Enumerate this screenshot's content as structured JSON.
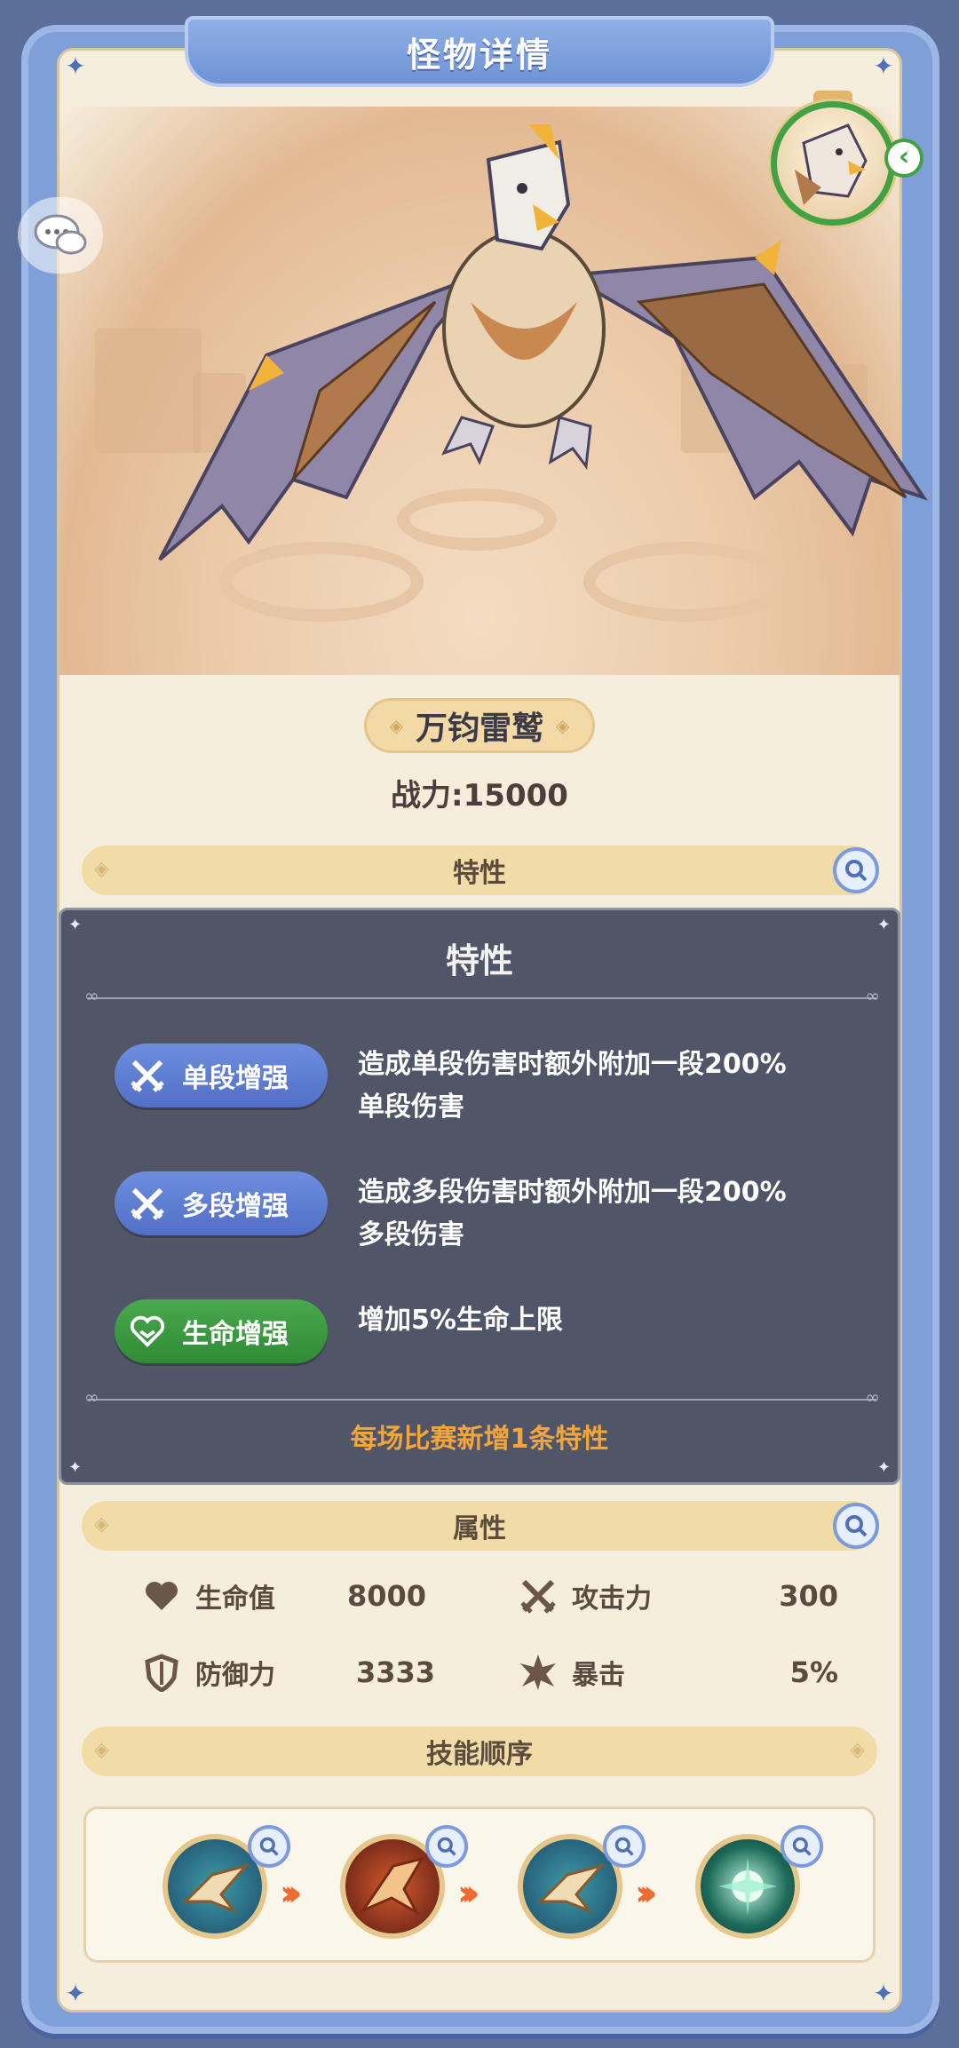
{
  "header": {
    "title": "怪物详情"
  },
  "monster": {
    "name": "万钧雷鹫",
    "power": "战力:15000"
  },
  "sections": {
    "traits": "特性",
    "attributes": "属性",
    "skill_order": "技能顺序"
  },
  "attributes": [
    {
      "icon": "heart-icon",
      "label": "生命值",
      "value": "8000"
    },
    {
      "icon": "crossed-swords-icon",
      "label": "攻击力",
      "value": "300"
    },
    {
      "icon": "shield-icon",
      "label": "防御力",
      "value": "3333"
    },
    {
      "icon": "starburst-icon",
      "label": "暴击",
      "value": "5%"
    }
  ],
  "skills": [
    {
      "icon": "eagle-skill-icon"
    },
    {
      "icon": "fire-bird-skill-icon"
    },
    {
      "icon": "eagle-skill-icon"
    },
    {
      "icon": "energy-orb-skill-icon"
    }
  ],
  "popup": {
    "title": "特性",
    "traits": [
      {
        "name": "单段增强",
        "icon": "crossed-swords-icon",
        "color": "#5a78d0",
        "desc_line1": "造成单段伤害时额外附加一段200%",
        "desc_line2": "单段伤害"
      },
      {
        "name": "多段增强",
        "icon": "crossed-swords-icon",
        "color": "#5a78d0",
        "desc_line1": "造成多段伤害时额外附加一段200%",
        "desc_line2": "多段伤害"
      },
      {
        "name": "生命增强",
        "icon": "heart-icon",
        "color": "#3a9a40",
        "desc_line1": "增加5%生命上限",
        "desc_line2": ""
      }
    ],
    "footer": "每场比赛新增1条特性"
  },
  "colors": {
    "frame": "#7f9fd8",
    "panel": "#f6eedd",
    "accent_orange": "#f3a53a",
    "section_bar": "#f1dca8"
  }
}
